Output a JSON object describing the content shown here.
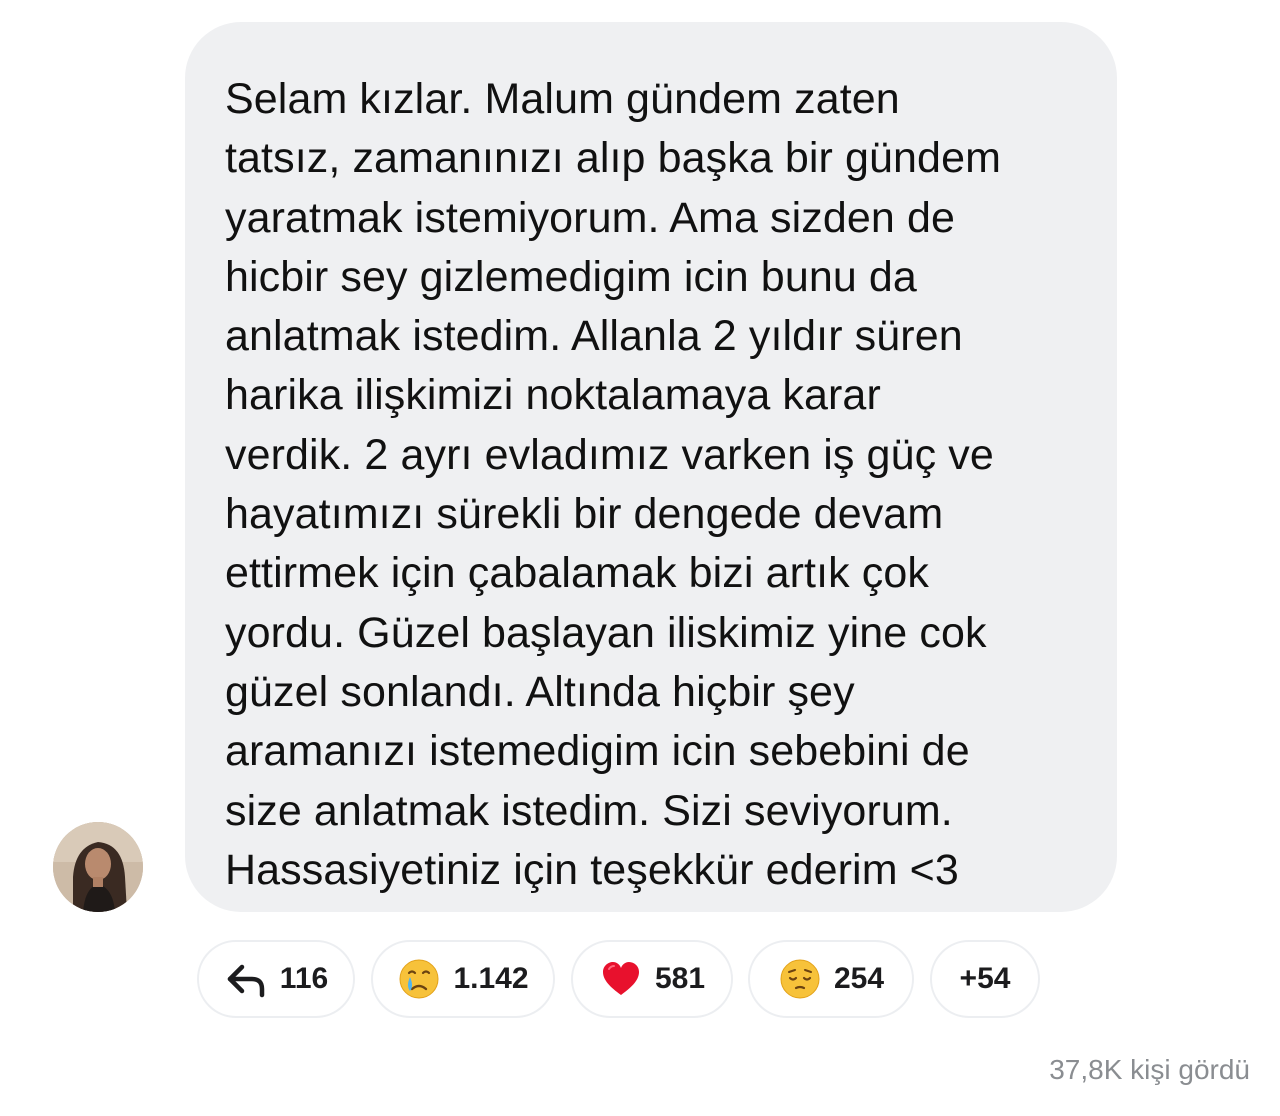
{
  "message": {
    "text": "Selam kızlar.  Malum gündem zaten\ntatsız, zamanınızı alıp başka bir gündem\nyaratmak istemiyorum. Ama sizden de\nhicbir sey gizlemedigim icin bunu da\nanlatmak istedim. Allanla 2 yıldır süren\nharika ilişkimizi noktalamaya karar\nverdik. 2 ayrı evladımız varken iş güç ve\nhayatımızı sürekli bir dengede devam\nettirmek için çabalamak bizi artık çok\nyordu. Güzel başlayan iliskimiz yine cok\ngüzel sonlandı. Altında hiçbir şey\naramanızı istemedigim icin sebebini de\nsize anlatmak istedim. Sizi seviyorum.\nHassasiyetiniz için teşekkür ederim <3"
  },
  "reactions": {
    "reply": {
      "icon": "reply-arrow-icon",
      "count": "116"
    },
    "crying": {
      "icon": "crying-face-emoji",
      "count": "1.142"
    },
    "heart": {
      "icon": "red-heart-emoji",
      "count": "581"
    },
    "sad": {
      "icon": "pensive-face-emoji",
      "count": "254"
    },
    "more": {
      "label": "+54"
    }
  },
  "views": "37,8K kişi gördü",
  "colors": {
    "bubble_bg": "#eff0f2",
    "text": "#111111",
    "muted": "#8a8d91",
    "pill_border": "#eceef1"
  }
}
